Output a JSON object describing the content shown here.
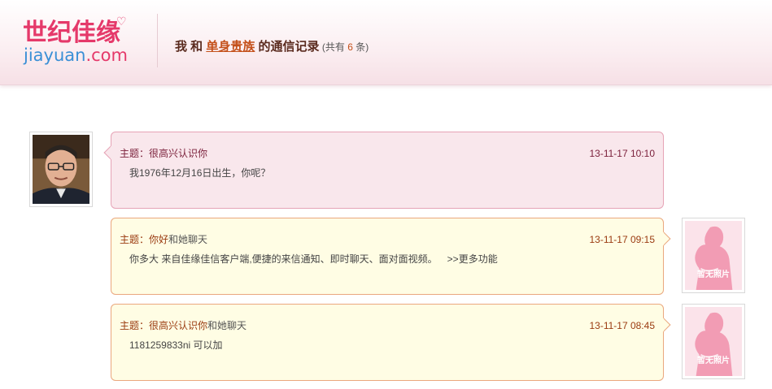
{
  "header": {
    "logo_cn": "世纪佳缘",
    "logo_en_a": "jiayuan",
    "logo_en_b": ".com",
    "title_prefix": "我 和 ",
    "nickname": "单身贵族",
    "title_suffix": " 的通信记录",
    "count_open": " (共有 ",
    "count": "6",
    "count_close": " 条)"
  },
  "messages": [
    {
      "subject_label": "主题：",
      "subject": "很高兴认识你",
      "subject_extra": "",
      "time": "13-11-17 10:10",
      "body": "我1976年12月16日出生，你呢？",
      "more": ""
    },
    {
      "subject_label": "主题：",
      "subject": "你好",
      "subject_extra": "和她聊天",
      "time": "13-11-17 09:15",
      "body": "你多大  来自佳缘佳信客户端,便捷的来信通知、即时聊天、面对面视频。",
      "more": ">>更多功能"
    },
    {
      "subject_label": "主题：",
      "subject": "很高兴认识你",
      "subject_extra": "和她聊天",
      "time": "13-11-17 08:45",
      "body": "1181259833ni 可以加",
      "more": ""
    }
  ],
  "no_photo_label": "暂无照片",
  "colors": {
    "brand_pink": "#e5396a",
    "brand_blue": "#3a8fd6",
    "accent": "#c4501a"
  }
}
